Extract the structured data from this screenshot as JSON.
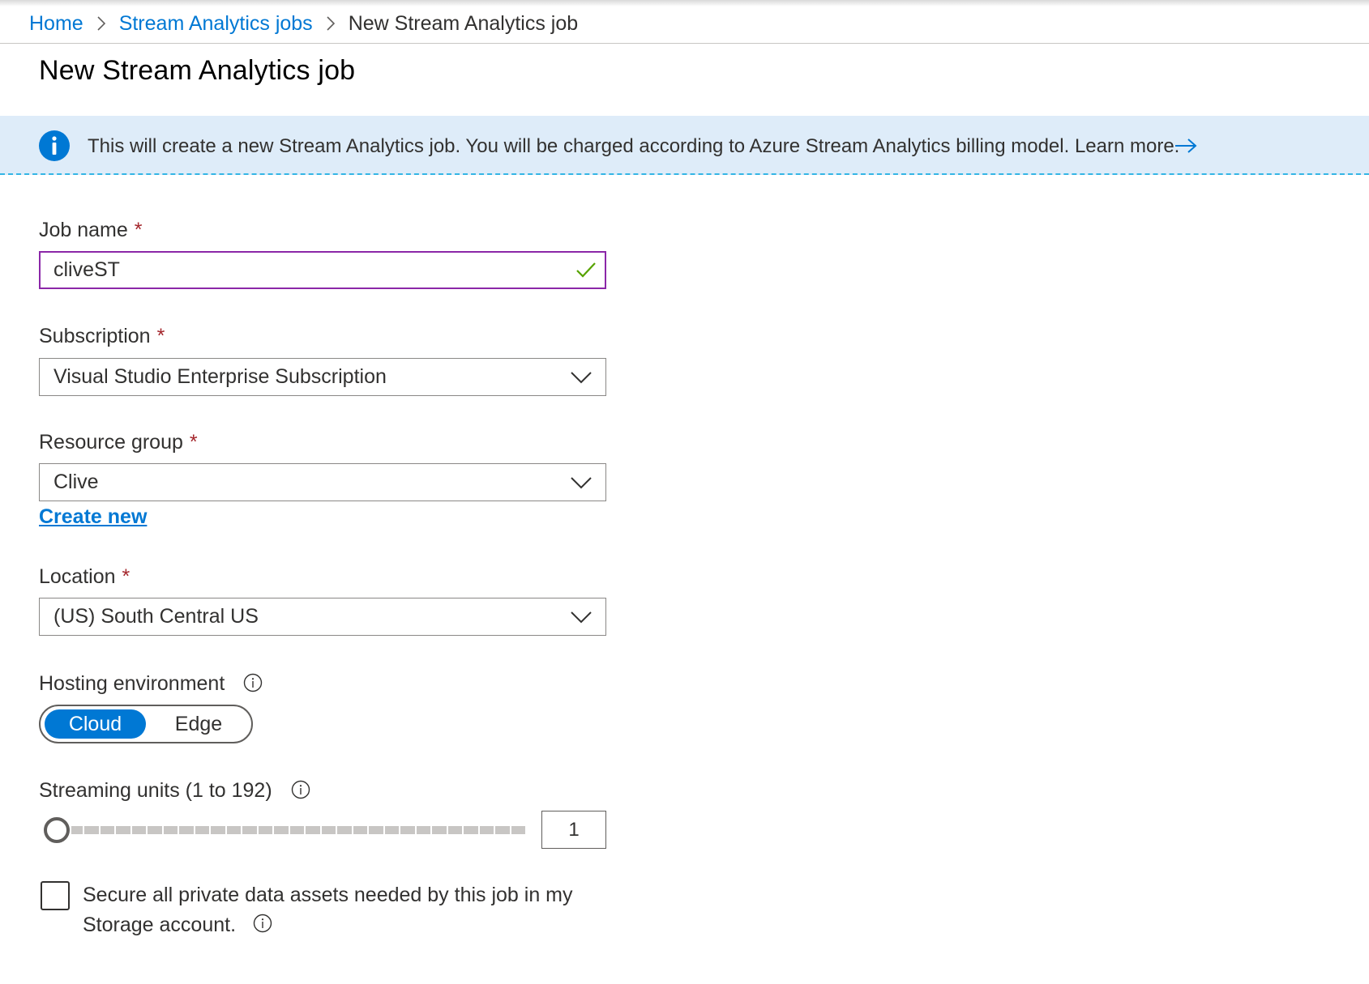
{
  "breadcrumb": {
    "home": "Home",
    "jobs": "Stream Analytics jobs",
    "current": "New Stream Analytics job"
  },
  "page": {
    "title": "New Stream Analytics job"
  },
  "banner": {
    "message": "This will create a new Stream Analytics job. You will be charged according to Azure Stream Analytics billing model. Learn more.",
    "icon": "info-icon",
    "link_icon": "arrow-right-icon"
  },
  "form": {
    "required_mark": "*",
    "job_name": {
      "label": "Job name",
      "value": "cliveST",
      "valid": true
    },
    "subscription": {
      "label": "Subscription",
      "value": "Visual Studio Enterprise Subscription"
    },
    "resource_group": {
      "label": "Resource group",
      "value": "Clive",
      "create_new": "Create new"
    },
    "location": {
      "label": "Location",
      "value": "(US) South Central US"
    },
    "hosting": {
      "label": "Hosting environment",
      "options": [
        "Cloud",
        "Edge"
      ],
      "selected": "Cloud"
    },
    "streaming_units": {
      "label": "Streaming units (1 to 192)",
      "value": "1",
      "min": 1,
      "max": 192
    },
    "secure": {
      "label": "Secure all private data assets needed by this job in my Storage account.",
      "checked": false
    }
  },
  "colors": {
    "accent": "#0078d4",
    "banner_bg": "#deecf9",
    "required": "#a4262c",
    "valid_check": "#57a300",
    "focus_border": "#8b27a8"
  }
}
